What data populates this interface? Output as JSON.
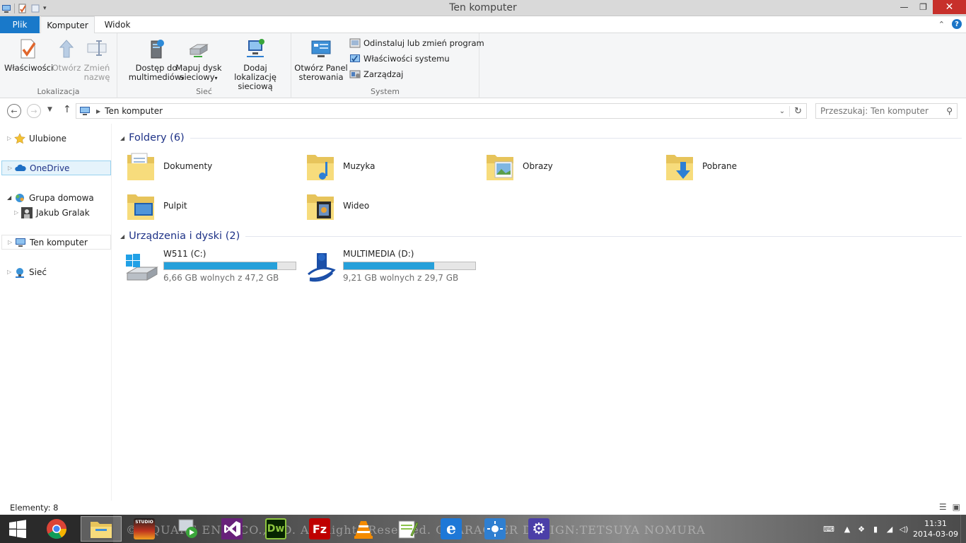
{
  "window": {
    "title": "Ten komputer",
    "controls": {
      "minimize": "—",
      "maximize": "❐",
      "close": "✕"
    }
  },
  "ribbon_tabs": [
    {
      "label": "Plik",
      "active": false
    },
    {
      "label": "Komputer",
      "active": true
    },
    {
      "label": "Widok",
      "active": false
    }
  ],
  "ribbon": {
    "lokalizacja": {
      "label": "Lokalizacja",
      "wlasciwosci": "Właściwości",
      "otworz": "Otwórz",
      "zmien_1": "Zmień",
      "zmien_2": "nazwę"
    },
    "siec": {
      "label": "Sieć",
      "dostep_1": "Dostęp do",
      "dostep_2": "multimediów",
      "mapuj_1": "Mapuj dysk",
      "mapuj_2": "sieciowy",
      "dodaj_1": "Dodaj lokalizację",
      "dodaj_2": "sieciową"
    },
    "system": {
      "label": "System",
      "panel_1": "Otwórz Panel",
      "panel_2": "sterowania",
      "odinstaluj": "Odinstaluj lub zmień program",
      "wlasciwosci_systemu": "Właściwości systemu",
      "zarzadzaj": "Zarządzaj"
    }
  },
  "address": {
    "path": "Ten komputer",
    "search_placeholder": "Przeszukaj: Ten komputer"
  },
  "nav": {
    "ulubione": "Ulubione",
    "onedrive": "OneDrive",
    "grupa": "Grupa domowa",
    "user": "Jakub Gralak",
    "komputer": "Ten komputer",
    "siec": "Sieć"
  },
  "folders_section": "Foldery (6)",
  "folders": [
    {
      "name": "Dokumenty"
    },
    {
      "name": "Muzyka"
    },
    {
      "name": "Obrazy"
    },
    {
      "name": "Pobrane"
    },
    {
      "name": "Pulpit"
    },
    {
      "name": "Wideo"
    }
  ],
  "drives_section": "Urządzenia i dyski (2)",
  "drives": [
    {
      "name": "W511 (C:)",
      "size": "6,66 GB wolnych z 47,2 GB",
      "used_fraction": 0.86
    },
    {
      "name": "MULTIMEDIA (D:)",
      "size": "9,21 GB wolnych z 29,7 GB",
      "used_fraction": 0.69
    }
  ],
  "status": {
    "count": "Elementy: 8"
  },
  "taskbar": {
    "clock_time": "11:31",
    "clock_date": "2014-03-09",
    "studio_label": "STUDIO",
    "dw_label": "Dw",
    "fz_label": "Fz",
    "ie_label": "e",
    "wallpaper_text": "© SQUARE ENIX CO.,LTD. All Rights Reserved. CHARACTER DESIGN:TETSUYA NOMURA"
  },
  "colors": {
    "accent": "#1979ca",
    "selection": "#e5f3fb",
    "section_title": "#1e3287",
    "bar_fill": "#26a0da"
  }
}
